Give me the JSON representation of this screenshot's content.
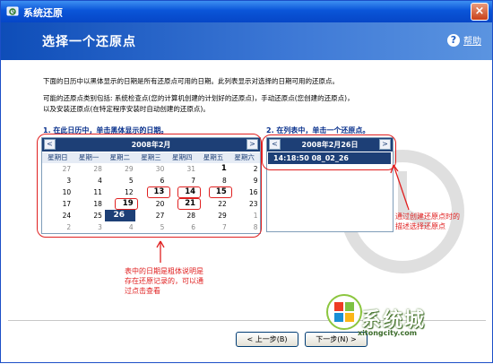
{
  "window": {
    "title": "系统还原",
    "close_glyph": "×"
  },
  "header": {
    "title": "选择一个还原点",
    "help_label": "帮助",
    "help_glyph": "?"
  },
  "description": {
    "line1": "下面的日历中以黑体显示的日期是所有还原点可用的日期。此列表显示对选择的日期可用的还原点。",
    "line2a": "可能的还原点类别包括: 系统检查点(您的计算机创建的计划好的还原点)，手动还原点(您创建的还原点)，",
    "line2b": "以及安装还原点(在特定程序安装时自动创建的还原点)。"
  },
  "step1": {
    "label": "1. 在此日历中，单击黑体显示的日期。"
  },
  "step2": {
    "label": "2. 在列表中，单击一个还原点。"
  },
  "calendar": {
    "month_label": "2008年2月",
    "prev": "<",
    "next": ">",
    "weekdays": [
      "星期日",
      "星期一",
      "星期二",
      "星期三",
      "星期四",
      "星期五",
      "星期六"
    ],
    "weeks": [
      [
        {
          "d": "27",
          "o": true
        },
        {
          "d": "28",
          "o": true
        },
        {
          "d": "29",
          "o": true
        },
        {
          "d": "30",
          "o": true
        },
        {
          "d": "31",
          "o": true
        },
        {
          "d": "1",
          "b": true
        },
        {
          "d": "2"
        }
      ],
      [
        {
          "d": "3"
        },
        {
          "d": "4"
        },
        {
          "d": "5"
        },
        {
          "d": "6"
        },
        {
          "d": "7"
        },
        {
          "d": "8"
        },
        {
          "d": "9"
        }
      ],
      [
        {
          "d": "10"
        },
        {
          "d": "11"
        },
        {
          "d": "12"
        },
        {
          "d": "13",
          "b": true
        },
        {
          "d": "14",
          "b": true
        },
        {
          "d": "15",
          "b": true
        },
        {
          "d": "16"
        }
      ],
      [
        {
          "d": "17"
        },
        {
          "d": "18"
        },
        {
          "d": "19",
          "b": true
        },
        {
          "d": "20"
        },
        {
          "d": "21",
          "b": true
        },
        {
          "d": "22"
        },
        {
          "d": "23"
        }
      ],
      [
        {
          "d": "24"
        },
        {
          "d": "25"
        },
        {
          "d": "26",
          "s": true
        },
        {
          "d": "27"
        },
        {
          "d": "28"
        },
        {
          "d": "29"
        },
        {
          "d": "1",
          "o": true
        }
      ],
      [
        {
          "d": "2",
          "o": true
        },
        {
          "d": "3",
          "o": true
        },
        {
          "d": "4",
          "o": true
        },
        {
          "d": "5",
          "o": true
        },
        {
          "d": "6",
          "o": true
        },
        {
          "d": "7",
          "o": true
        },
        {
          "d": "8",
          "o": true
        }
      ]
    ]
  },
  "restore_list": {
    "date_label": "2008年2月26日",
    "prev": "<",
    "next": ">",
    "items": [
      "14:18:50  08_02_26"
    ]
  },
  "annotations": {
    "list_note_1": "通过创建还原点时的",
    "list_note_2": "描述选择还原点",
    "cal_note_1": "表中的日期是粗体说明是",
    "cal_note_2": "存在还原记录的，可以通",
    "cal_note_3": "过点击查看"
  },
  "buttons": {
    "back": "< 上一步(B)",
    "next": "下一步(N) >"
  },
  "logo": {
    "text": "系统城",
    "url": "xitongcity.com"
  },
  "colors": {
    "title_blue": "#0a55d8",
    "header_blue": "#0e4db8",
    "calendar_navy": "#1d3f76",
    "annotation_red": "#e02020"
  }
}
